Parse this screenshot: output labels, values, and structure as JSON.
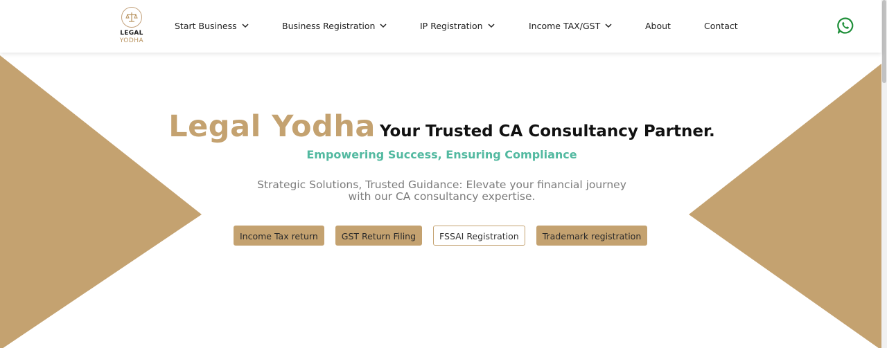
{
  "brand": {
    "logo_line1": "LEGAL",
    "logo_line2": "YODHA"
  },
  "nav": {
    "items": [
      {
        "label": "Start Business",
        "dropdown": true
      },
      {
        "label": "Business Registration",
        "dropdown": true
      },
      {
        "label": "IP Registration",
        "dropdown": true
      },
      {
        "label": "Income TAX/GST",
        "dropdown": true
      },
      {
        "label": "About",
        "dropdown": false
      },
      {
        "label": "Contact",
        "dropdown": false
      }
    ],
    "whatsapp_icon": "whatsapp-icon"
  },
  "hero": {
    "brand_name": "Legal Yodha",
    "tagline": "Your Trusted CA Consultancy Partner.",
    "subheading": "Empowering Success, Ensuring Compliance",
    "description_line1": "Strategic Solutions, Trusted Guidance: Elevate your financial journey",
    "description_line2": "with our CA consultancy expertise.",
    "buttons": [
      {
        "label": "Income Tax return",
        "style": "filled"
      },
      {
        "label": "GST Return Filing",
        "style": "filled"
      },
      {
        "label": "FSSAI Registration",
        "style": "outline"
      },
      {
        "label": "Trademark registration",
        "style": "filled"
      }
    ]
  },
  "colors": {
    "accent_gold": "#c4a270",
    "subheading_teal": "#52b9a0",
    "whatsapp_green": "#1f8f3a"
  }
}
